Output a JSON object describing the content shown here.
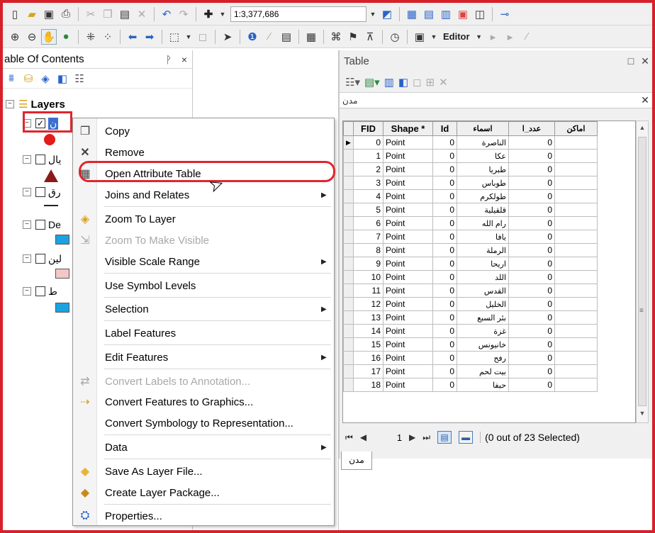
{
  "toolbar1": {
    "icons": [
      "new-icon",
      "open-icon",
      "save-icon",
      "print-icon",
      "cut-icon",
      "copy-icon",
      "paste-icon",
      "delete-icon",
      "undo-icon",
      "redo-icon",
      "add-data-icon"
    ],
    "scale_value": "1:3,377,686",
    "right_icons": [
      "editor-toolbar-icon",
      "table-icon",
      "catalog-icon",
      "search-icon",
      "arctoolbox-icon",
      "python-icon",
      "model-icon"
    ]
  },
  "toolbar2": {
    "editor_label": "Editor",
    "icons": [
      "zoom-in-icon",
      "zoom-out-icon",
      "pan-icon",
      "full-extent-icon",
      "fixed-zoom-in-icon",
      "fixed-zoom-out-icon",
      "back-icon",
      "forward-icon",
      "select-features-icon",
      "clear-selection-icon",
      "select-elements-icon",
      "identify-icon",
      "html-popup-icon",
      "measure-icon",
      "find-icon",
      "route-icon",
      "goto-xy-icon",
      "time-slider-icon",
      "viewer-icon"
    ]
  },
  "toc": {
    "title": "able Of Contents",
    "pin": "ਚ",
    "close": "×",
    "layers_label": "Layers",
    "rows": [
      {
        "label": "ن",
        "checked": true
      },
      {
        "label": "يال",
        "checked": false
      },
      {
        "label": "رق",
        "checked": false
      },
      {
        "label": "De",
        "checked": false
      },
      {
        "label": "لين",
        "checked": false
      },
      {
        "label": "ط",
        "checked": false
      }
    ]
  },
  "context_menu": {
    "items": [
      {
        "label": "Copy",
        "icon": "copy-icon",
        "disabled": false,
        "submenu": false
      },
      {
        "label": "Remove",
        "icon": "remove-icon",
        "disabled": false,
        "submenu": false
      },
      {
        "label": "Open Attribute Table",
        "icon": "table-icon",
        "disabled": false,
        "submenu": false
      },
      {
        "label": "Joins and Relates",
        "icon": "",
        "disabled": false,
        "submenu": true
      },
      {
        "label": "Zoom To Layer",
        "icon": "zoom-to-layer-icon",
        "disabled": false,
        "submenu": false
      },
      {
        "label": "Zoom To Make Visible",
        "icon": "zoom-visible-icon",
        "disabled": true,
        "submenu": false
      },
      {
        "label": "Visible Scale Range",
        "icon": "",
        "disabled": false,
        "submenu": true
      },
      {
        "label": "Use Symbol Levels",
        "icon": "",
        "disabled": false,
        "submenu": false
      },
      {
        "label": "Selection",
        "icon": "",
        "disabled": false,
        "submenu": true
      },
      {
        "label": "Label Features",
        "icon": "",
        "disabled": false,
        "submenu": false
      },
      {
        "label": "Edit Features",
        "icon": "",
        "disabled": false,
        "submenu": true
      },
      {
        "label": "Convert Labels to Annotation...",
        "icon": "convert-labels-icon",
        "disabled": true,
        "submenu": false
      },
      {
        "label": "Convert Features to Graphics...",
        "icon": "convert-features-icon",
        "disabled": false,
        "submenu": false
      },
      {
        "label": "Convert Symbology to Representation...",
        "icon": "",
        "disabled": false,
        "submenu": false
      },
      {
        "label": "Data",
        "icon": "",
        "disabled": false,
        "submenu": true
      },
      {
        "label": "Save As Layer File...",
        "icon": "save-layer-icon",
        "disabled": false,
        "submenu": false
      },
      {
        "label": "Create Layer Package...",
        "icon": "layer-package-icon",
        "disabled": false,
        "submenu": false
      },
      {
        "label": "Properties...",
        "icon": "properties-icon",
        "disabled": false,
        "submenu": false
      }
    ]
  },
  "table_window": {
    "title": "Table",
    "tab_name": "مدن",
    "columns": [
      "FID",
      "Shape *",
      "Id",
      "اسماء",
      "عدد_ا",
      "اماكن"
    ],
    "rows": [
      [
        "0",
        "Point",
        "0",
        "الناصرة",
        "0",
        ""
      ],
      [
        "1",
        "Point",
        "0",
        "عكا",
        "0",
        ""
      ],
      [
        "2",
        "Point",
        "0",
        "طبريا",
        "0",
        ""
      ],
      [
        "3",
        "Point",
        "0",
        "طوباس",
        "0",
        ""
      ],
      [
        "4",
        "Point",
        "0",
        "طولكرم",
        "0",
        ""
      ],
      [
        "5",
        "Point",
        "0",
        "قلقيلية",
        "0",
        ""
      ],
      [
        "6",
        "Point",
        "0",
        "رام الله",
        "0",
        ""
      ],
      [
        "7",
        "Point",
        "0",
        "يافا",
        "0",
        ""
      ],
      [
        "8",
        "Point",
        "0",
        "الرملة",
        "0",
        ""
      ],
      [
        "9",
        "Point",
        "0",
        "اريحا",
        "0",
        ""
      ],
      [
        "10",
        "Point",
        "0",
        "اللد",
        "0",
        ""
      ],
      [
        "11",
        "Point",
        "0",
        "القدس",
        "0",
        ""
      ],
      [
        "12",
        "Point",
        "0",
        "الخليل",
        "0",
        ""
      ],
      [
        "13",
        "Point",
        "0",
        "بئر السبع",
        "0",
        ""
      ],
      [
        "14",
        "Point",
        "0",
        "غزة",
        "0",
        ""
      ],
      [
        "15",
        "Point",
        "0",
        "خانيونس",
        "0",
        ""
      ],
      [
        "16",
        "Point",
        "0",
        "رفح",
        "0",
        ""
      ],
      [
        "17",
        "Point",
        "0",
        "بيت لحم",
        "0",
        ""
      ],
      [
        "18",
        "Point",
        "0",
        "حيفا",
        "0",
        ""
      ]
    ],
    "current_page": "1",
    "selection_status": "(0 out of 23 Selected)",
    "bottom_tab": "مدن"
  },
  "colors": {
    "highlight_red": "#e0262e",
    "frame_red": "#d6202a",
    "point_symbol": "#e21b1b",
    "triangle_symbol": "#8b1a1a",
    "polygon_blue": "#1aa3e0",
    "polygon_pink": "#f4c6c6"
  }
}
